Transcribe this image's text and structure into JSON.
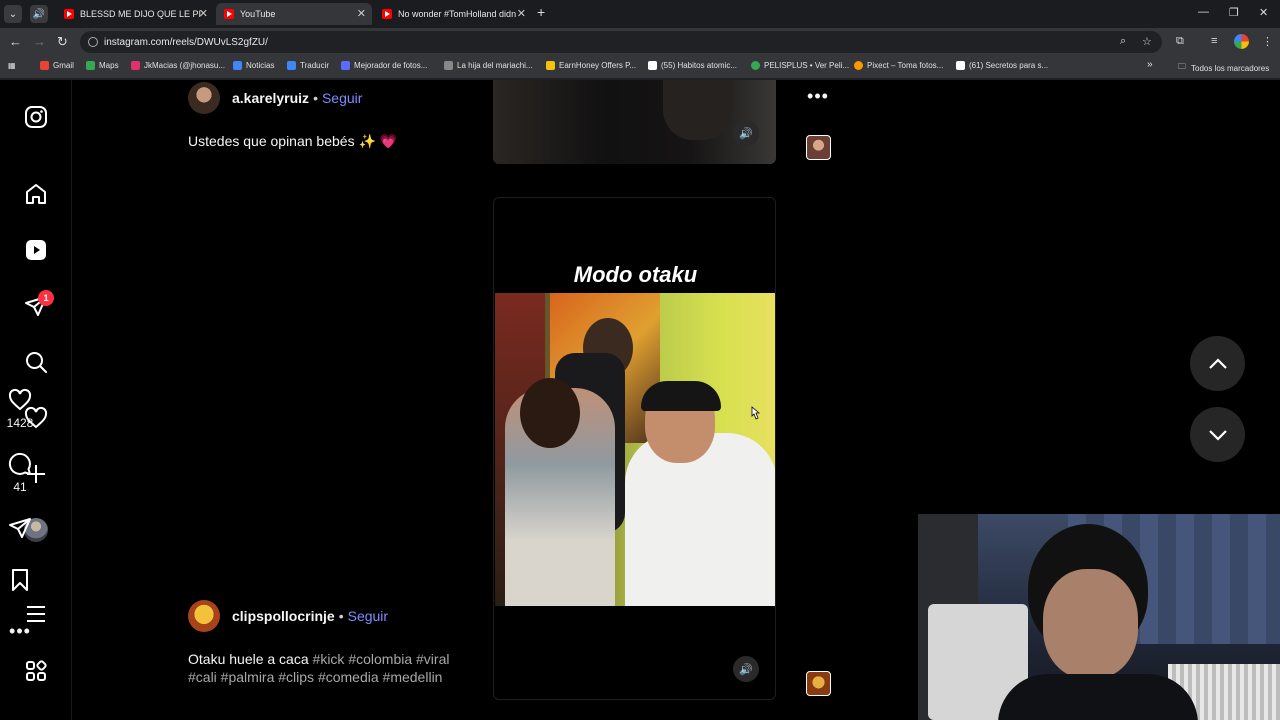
{
  "browser": {
    "tabs": [
      {
        "label": "BLESSD ME DIJO QUE LE PI",
        "active": false
      },
      {
        "label": "YouTube",
        "active": true
      },
      {
        "label": "No wonder #TomHolland didn",
        "active": false
      }
    ],
    "new_tab": "+",
    "url": "instagram.com/reels/DWUvLS2gfZU/",
    "bookmarks": [
      {
        "label": "Gmail",
        "color": "#ea4335"
      },
      {
        "label": "Maps",
        "color": "#34a853"
      },
      {
        "label": "JkMacias (@jhonasu...",
        "color": "#e1306c"
      },
      {
        "label": "Noticias",
        "color": "#4285f4"
      },
      {
        "label": "Traducir",
        "color": "#4285f4"
      },
      {
        "label": "Mejorador de fotos...",
        "color": "#5b6bff"
      },
      {
        "label": "La hija del mariachi...",
        "color": "#888888"
      },
      {
        "label": "EarnHoney Offers P...",
        "color": "#f4c20d"
      },
      {
        "label": "(55) Habitos atomic...",
        "color": "#ffffff"
      },
      {
        "label": "PELISPLUS • Ver Peli...",
        "color": "#34a853"
      },
      {
        "label": "Pixect – Toma fotos...",
        "color": "#ff9800"
      },
      {
        "label": "(61) Secretos para s...",
        "color": "#ffffff"
      }
    ],
    "bookmarks_more": "»",
    "all_bookmarks": "Todos los marcadores"
  },
  "sidebar": {
    "notification_count": "1"
  },
  "post_top": {
    "username": "a.karelyruiz",
    "separator": "•",
    "follow": "Seguir",
    "caption": "Ustedes que opinan bebés ✨ 💗"
  },
  "post_main": {
    "username": "clipspollocrinje",
    "separator": "•",
    "follow": "Seguir",
    "caption_text": "Otaku huele a caca",
    "hashtags_line1": "#kick #colombia #viral",
    "hashtags_line2": "#cali #palmira #clips #comedia #medellin",
    "video_title": "Modo otaku",
    "likes": "1428",
    "comments": "41"
  },
  "colors": {
    "accent_follow": "#7f8cff",
    "notification": "#ff3040"
  }
}
